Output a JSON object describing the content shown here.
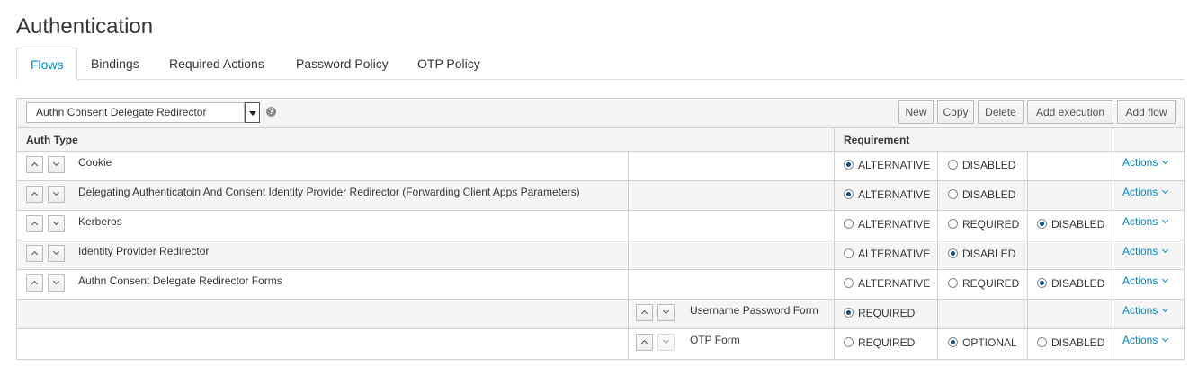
{
  "page": {
    "title": "Authentication"
  },
  "tabs": [
    {
      "label": "Flows",
      "active": true
    },
    {
      "label": "Bindings",
      "active": false
    },
    {
      "label": "Required Actions",
      "active": false
    },
    {
      "label": "Password Policy",
      "active": false
    },
    {
      "label": "OTP Policy",
      "active": false
    }
  ],
  "toolbar": {
    "flow_select_value": "Authn Consent Delegate Redirector",
    "new_label": "New",
    "copy_label": "Copy",
    "delete_label": "Delete",
    "add_execution_label": "Add execution",
    "add_flow_label": "Add flow"
  },
  "table": {
    "headers": {
      "auth_type": "Auth Type",
      "requirement": "Requirement"
    },
    "actions_label": "Actions",
    "rows": [
      {
        "name": "Cookie",
        "level": 0,
        "options": [
          {
            "label": "ALTERNATIVE",
            "checked": true
          },
          {
            "label": "DISABLED",
            "checked": false
          }
        ]
      },
      {
        "name": "Delegating Authenticatoin And Consent Identity Provider Redirector   (Forwarding Client Apps Parameters)",
        "level": 0,
        "options": [
          {
            "label": "ALTERNATIVE",
            "checked": true
          },
          {
            "label": "DISABLED",
            "checked": false
          }
        ]
      },
      {
        "name": "Kerberos",
        "level": 0,
        "options": [
          {
            "label": "ALTERNATIVE",
            "checked": false
          },
          {
            "label": "REQUIRED",
            "checked": false
          },
          {
            "label": "DISABLED",
            "checked": true
          }
        ]
      },
      {
        "name": "Identity Provider Redirector",
        "level": 0,
        "options": [
          {
            "label": "ALTERNATIVE",
            "checked": false
          },
          {
            "label": "DISABLED",
            "checked": true
          }
        ]
      },
      {
        "name": "Authn Consent Delegate Redirector Forms",
        "level": 0,
        "options": [
          {
            "label": "ALTERNATIVE",
            "checked": false
          },
          {
            "label": "REQUIRED",
            "checked": false
          },
          {
            "label": "DISABLED",
            "checked": true
          }
        ]
      },
      {
        "name": "Username Password Form",
        "level": 1,
        "options": [
          {
            "label": "REQUIRED",
            "checked": true
          }
        ]
      },
      {
        "name": "OTP Form",
        "level": 1,
        "options": [
          {
            "label": "REQUIRED",
            "checked": false
          },
          {
            "label": "OPTIONAL",
            "checked": true
          },
          {
            "label": "DISABLED",
            "checked": false
          }
        ]
      }
    ]
  }
}
